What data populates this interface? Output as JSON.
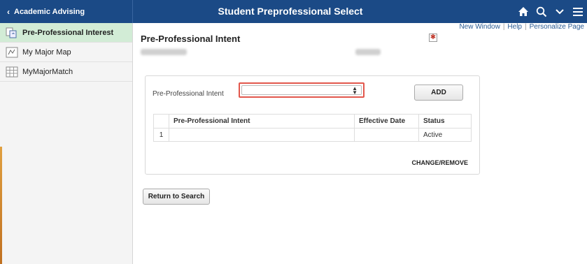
{
  "header": {
    "back_label": "Academic Advising",
    "title": "Student Preprofessional Select"
  },
  "sidebar": {
    "items": [
      {
        "label": "Pre-Professional Interest",
        "icon": "transfer-icon",
        "active": true
      },
      {
        "label": "My Major Map",
        "icon": "map-icon",
        "active": false
      },
      {
        "label": "MyMajorMatch",
        "icon": "grid-icon",
        "active": false
      }
    ]
  },
  "links": {
    "new_window": "New Window",
    "help": "Help",
    "personalize": "Personalize Page",
    "separator": "|"
  },
  "main": {
    "page_title": "Pre-Professional Intent",
    "field_label": "Pre-Professional Intent",
    "select_value": "",
    "add_label": "ADD",
    "table": {
      "headers": [
        "",
        "Pre-Professional Intent",
        "Effective Date",
        "Status"
      ],
      "rows": [
        {
          "num": "1",
          "intent": "",
          "date": "",
          "status": "Active"
        }
      ]
    },
    "change_remove_label": "CHANGE/REMOVE",
    "return_label": "Return to Search"
  },
  "colors": {
    "header_bg": "#1b4a86",
    "active_item_bg": "#d2ecd6",
    "highlight_border": "#e2574c"
  }
}
